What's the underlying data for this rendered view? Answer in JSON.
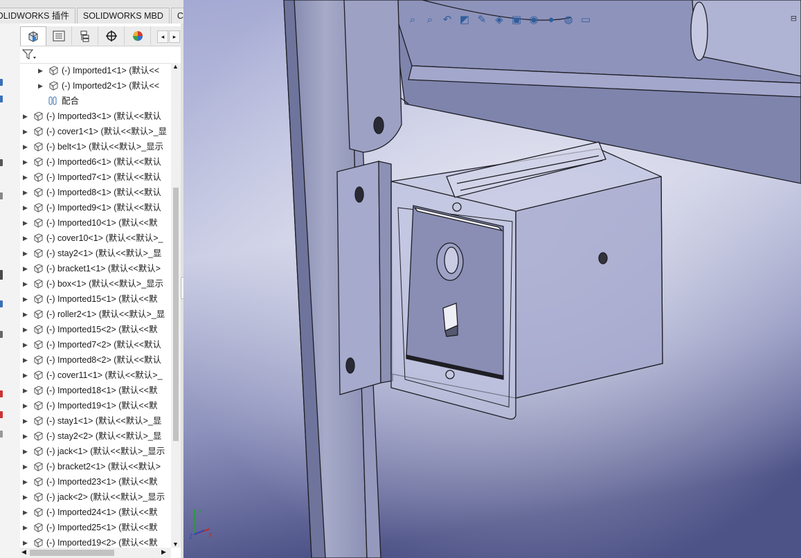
{
  "tabs": [
    "OLIDWORKS 插件",
    "SOLIDWORKS MBD",
    "CircuitWorks"
  ],
  "feature_manager": {
    "tab_icons": [
      "assembly-icon",
      "property-manager-icon",
      "configuration-manager-icon",
      "dimxpert-icon",
      "display-manager-icon"
    ],
    "tree": [
      {
        "label": "(-) Imported1<1> (默认<<",
        "indent": 1,
        "expandable": true,
        "icon": "part-icon"
      },
      {
        "label": "(-) Imported2<1> (默认<<",
        "indent": 1,
        "expandable": true,
        "icon": "part-icon"
      },
      {
        "label": "配合",
        "indent": 1,
        "expandable": false,
        "icon": "mates-icon"
      },
      {
        "label": "(-) Imported3<1> (默认<<默认",
        "indent": 0,
        "expandable": true,
        "icon": "part-icon"
      },
      {
        "label": "(-) cover1<1> (默认<<默认>_显",
        "indent": 0,
        "expandable": true,
        "icon": "part-icon"
      },
      {
        "label": "(-) belt<1> (默认<<默认>_显示",
        "indent": 0,
        "expandable": true,
        "icon": "part-icon"
      },
      {
        "label": "(-) Imported6<1> (默认<<默认",
        "indent": 0,
        "expandable": true,
        "icon": "part-icon"
      },
      {
        "label": "(-) Imported7<1> (默认<<默认",
        "indent": 0,
        "expandable": true,
        "icon": "part-icon"
      },
      {
        "label": "(-) Imported8<1> (默认<<默认",
        "indent": 0,
        "expandable": true,
        "icon": "part-icon"
      },
      {
        "label": "(-) Imported9<1> (默认<<默认",
        "indent": 0,
        "expandable": true,
        "icon": "part-icon"
      },
      {
        "label": "(-) Imported10<1> (默认<<默",
        "indent": 0,
        "expandable": true,
        "icon": "part-icon"
      },
      {
        "label": "(-) cover10<1> (默认<<默认>_",
        "indent": 0,
        "expandable": true,
        "icon": "part-icon"
      },
      {
        "label": "(-) stay2<1> (默认<<默认>_显",
        "indent": 0,
        "expandable": true,
        "icon": "part-icon"
      },
      {
        "label": "(-) bracket1<1> (默认<<默认>",
        "indent": 0,
        "expandable": true,
        "icon": "part-icon"
      },
      {
        "label": "(-) box<1> (默认<<默认>_显示",
        "indent": 0,
        "expandable": true,
        "icon": "part-icon"
      },
      {
        "label": "(-) Imported15<1> (默认<<默",
        "indent": 0,
        "expandable": true,
        "icon": "part-icon"
      },
      {
        "label": "(-) roller2<1> (默认<<默认>_显",
        "indent": 0,
        "expandable": true,
        "icon": "part-icon"
      },
      {
        "label": "(-) Imported15<2> (默认<<默",
        "indent": 0,
        "expandable": true,
        "icon": "part-icon"
      },
      {
        "label": "(-) Imported7<2> (默认<<默认",
        "indent": 0,
        "expandable": true,
        "icon": "part-icon"
      },
      {
        "label": "(-) Imported8<2> (默认<<默认",
        "indent": 0,
        "expandable": true,
        "icon": "part-icon"
      },
      {
        "label": "(-) cover11<1> (默认<<默认>_",
        "indent": 0,
        "expandable": true,
        "icon": "part-icon"
      },
      {
        "label": "(-) Imported18<1> (默认<<默",
        "indent": 0,
        "expandable": true,
        "icon": "part-icon"
      },
      {
        "label": "(-) Imported19<1> (默认<<默",
        "indent": 0,
        "expandable": true,
        "icon": "part-icon"
      },
      {
        "label": "(-) stay1<1> (默认<<默认>_显",
        "indent": 0,
        "expandable": true,
        "icon": "part-icon"
      },
      {
        "label": "(-) stay2<2> (默认<<默认>_显",
        "indent": 0,
        "expandable": true,
        "icon": "part-icon"
      },
      {
        "label": "(-) jack<1> (默认<<默认>_显示",
        "indent": 0,
        "expandable": true,
        "icon": "part-icon"
      },
      {
        "label": "(-) bracket2<1> (默认<<默认>",
        "indent": 0,
        "expandable": true,
        "icon": "part-icon"
      },
      {
        "label": "(-) Imported23<1> (默认<<默",
        "indent": 0,
        "expandable": true,
        "icon": "part-icon"
      },
      {
        "label": "(-) jack<2> (默认<<默认>_显示",
        "indent": 0,
        "expandable": true,
        "icon": "part-icon"
      },
      {
        "label": "(-) Imported24<1> (默认<<默",
        "indent": 0,
        "expandable": true,
        "icon": "part-icon"
      },
      {
        "label": "(-) Imported25<1> (默认<<默",
        "indent": 0,
        "expandable": true,
        "icon": "part-icon"
      },
      {
        "label": "(-) Imported19<2> (默认<<默",
        "indent": 0,
        "expandable": true,
        "icon": "part-icon"
      }
    ]
  },
  "heads_up_toolbar": [
    "zoom-to-fit-icon",
    "zoom-to-area-icon",
    "previous-view-icon",
    "section-view-icon",
    "dynamic-annotation-icon",
    "view-orientation-icon",
    "display-style-icon",
    "hide-show-items-icon",
    "edit-appearance-icon",
    "apply-scene-icon",
    "view-settings-icon"
  ],
  "colors": {
    "viewport_top": "#9aa0c6",
    "viewport_bottom": "#4e5388",
    "part_face": "#a9aed0",
    "part_edge": "#1e1e24"
  },
  "triad": {
    "x": "X",
    "y": "Y",
    "z": "Z"
  }
}
